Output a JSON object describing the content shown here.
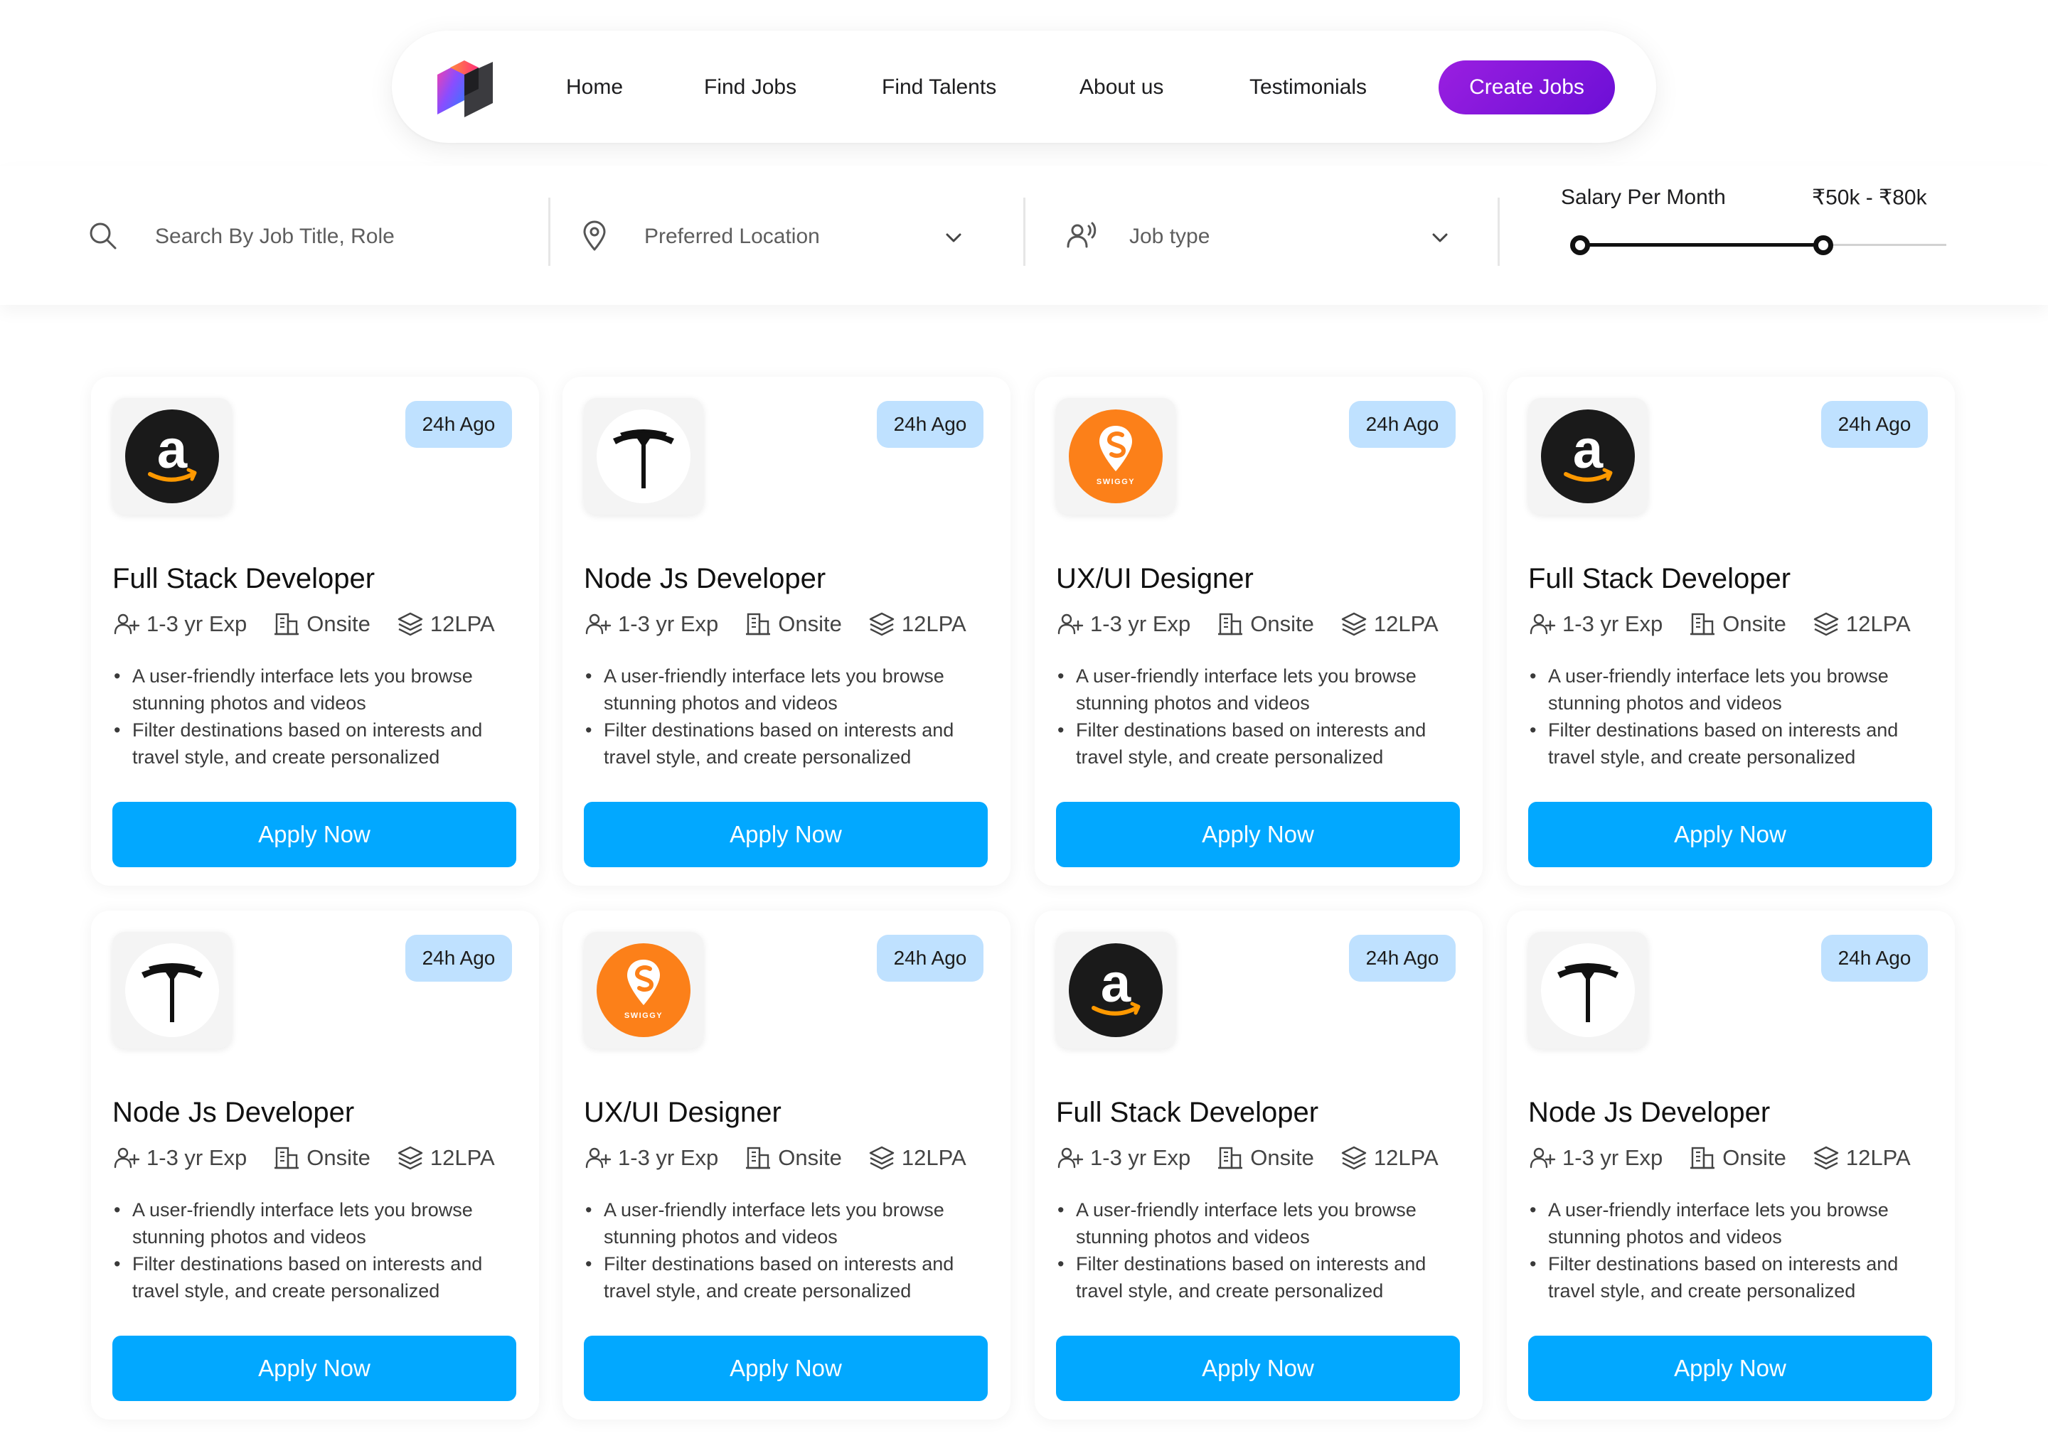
{
  "nav": {
    "links": [
      "Home",
      "Find Jobs",
      "Find Talents",
      "About us",
      "Testimonials"
    ],
    "cta_label": "Create Jobs"
  },
  "filters": {
    "search_placeholder": "Search By Job Title, Role",
    "location_placeholder": "Preferred Location",
    "jobtype_placeholder": "Job type",
    "salary_label": "Salary Per Month",
    "salary_range": "₹50k - ₹80k",
    "salary_range_fill": 0.664
  },
  "colors": {
    "accent": "#02a8ff",
    "cta": "#7b12dc",
    "badge": "#bfe1ff"
  },
  "jobs": [
    {
      "company_icon": "amazon-logo-icon",
      "posted": "24h Ago",
      "title": "Full Stack Developer",
      "experience": "1-3 yr Exp",
      "workplace": "Onsite",
      "salary": "12LPA",
      "bullets": [
        "A user-friendly interface lets you browse stunning photos and videos",
        "Filter destinations based on interests and travel style, and create personalized"
      ],
      "cta": "Apply Now"
    },
    {
      "company_icon": "tesla-logo-icon",
      "posted": "24h Ago",
      "title": "Node Js Developer",
      "experience": "1-3 yr Exp",
      "workplace": "Onsite",
      "salary": "12LPA",
      "bullets": [
        "A user-friendly interface lets you browse stunning photos and videos",
        "Filter destinations based on interests and travel style, and create personalized"
      ],
      "cta": "Apply Now"
    },
    {
      "company_icon": "swiggy-logo-icon",
      "logo_text": "SWIGGY",
      "posted": "24h Ago",
      "title": "UX/UI Designer",
      "experience": "1-3 yr Exp",
      "workplace": "Onsite",
      "salary": "12LPA",
      "bullets": [
        "A user-friendly interface lets you browse stunning photos and videos",
        "Filter destinations based on interests and travel style, and create personalized"
      ],
      "cta": "Apply Now"
    },
    {
      "company_icon": "amazon-logo-icon",
      "posted": "24h Ago",
      "title": "Full Stack Developer",
      "experience": "1-3 yr Exp",
      "workplace": "Onsite",
      "salary": "12LPA",
      "bullets": [
        "A user-friendly interface lets you browse stunning photos and videos",
        "Filter destinations based on interests and travel style, and create personalized"
      ],
      "cta": "Apply Now"
    },
    {
      "company_icon": "tesla-logo-icon",
      "posted": "24h Ago",
      "title": "Node Js Developer",
      "experience": "1-3 yr Exp",
      "workplace": "Onsite",
      "salary": "12LPA",
      "bullets": [
        "A user-friendly interface lets you browse stunning photos and videos",
        "Filter destinations based on interests and travel style, and create personalized"
      ],
      "cta": "Apply Now"
    },
    {
      "company_icon": "swiggy-logo-icon",
      "logo_text": "SWIGGY",
      "posted": "24h Ago",
      "title": "UX/UI Designer",
      "experience": "1-3 yr Exp",
      "workplace": "Onsite",
      "salary": "12LPA",
      "bullets": [
        "A user-friendly interface lets you browse stunning photos and videos",
        "Filter destinations based on interests and travel style, and create personalized"
      ],
      "cta": "Apply Now"
    },
    {
      "company_icon": "amazon-logo-icon",
      "posted": "24h Ago",
      "title": "Full Stack Developer",
      "experience": "1-3 yr Exp",
      "workplace": "Onsite",
      "salary": "12LPA",
      "bullets": [
        "A user-friendly interface lets you browse stunning photos and videos",
        "Filter destinations based on interests and travel style, and create personalized"
      ],
      "cta": "Apply Now"
    },
    {
      "company_icon": "tesla-logo-icon",
      "posted": "24h Ago",
      "title": "Node Js Developer",
      "experience": "1-3 yr Exp",
      "workplace": "Onsite",
      "salary": "12LPA",
      "bullets": [
        "A user-friendly interface lets you browse stunning photos and videos",
        "Filter destinations based on interests and travel style, and create personalized"
      ],
      "cta": "Apply Now"
    }
  ]
}
